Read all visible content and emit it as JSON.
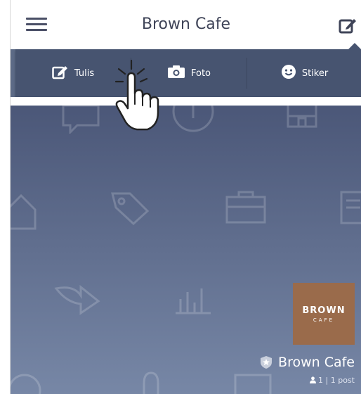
{
  "header": {
    "title": "Brown Cafe"
  },
  "compose_menu": {
    "items": [
      {
        "label": "Tulis",
        "icon": "compose-icon"
      },
      {
        "label": "Foto",
        "icon": "camera-icon"
      },
      {
        "label": "Stiker",
        "icon": "sticker-icon"
      }
    ]
  },
  "profile": {
    "logo_line1": "BROWN",
    "logo_line2": "CAFE",
    "name": "Brown Cafe",
    "meta": "1 | 1 post"
  },
  "colors": {
    "menu_bg": "#475470",
    "cover_top": "#4b5778",
    "cover_bottom": "#7787a6",
    "logo_bg": "#9a6b4b",
    "title_color": "#3f4458"
  }
}
